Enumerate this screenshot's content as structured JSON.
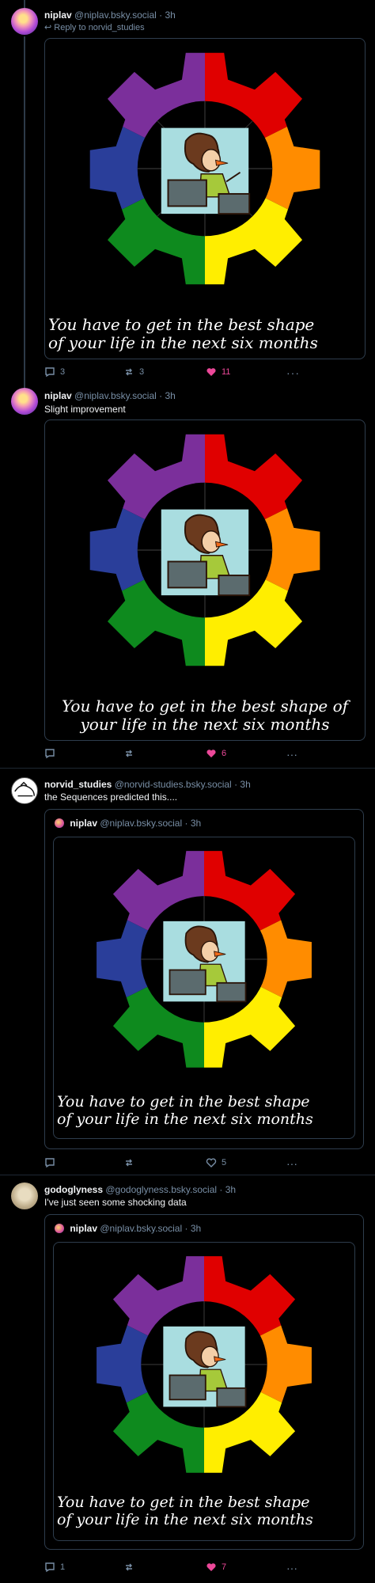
{
  "posts": [
    {
      "author": "niplav",
      "handle": "@niplav.bsky.social",
      "time": "3h",
      "reply_to": "Reply to norvid_studies",
      "caption": "You have to get in the best shape of your life in the next six months",
      "stats": {
        "replies": "3",
        "reposts": "3",
        "likes": "11",
        "liked": true
      }
    },
    {
      "author": "niplav",
      "handle": "@niplav.bsky.social",
      "time": "3h",
      "text": "Slight improvement",
      "caption": "You have to get in the best shape of your life in the next six months",
      "stats": {
        "replies": "",
        "reposts": "",
        "likes": "6",
        "liked": true
      }
    },
    {
      "author": "norvid_studies",
      "handle": "@norvid-studies.bsky.social",
      "time": "3h",
      "text": "the Sequences predicted this....",
      "quote": {
        "author": "niplav",
        "handle": "@niplav.bsky.social",
        "time": "3h"
      },
      "caption": "You have to get in the best shape of your life in the next six months",
      "stats": {
        "replies": "",
        "reposts": "",
        "likes": "5",
        "liked": false
      }
    },
    {
      "author": "godoglyness",
      "handle": "@godoglyness.bsky.social",
      "time": "3h",
      "text": "I've just seen some shocking data",
      "quote": {
        "author": "niplav",
        "handle": "@niplav.bsky.social",
        "time": "3h"
      },
      "caption": "You have to get in the best shape of your life in the next six months",
      "stats": {
        "replies": "1",
        "reposts": "",
        "likes": "7",
        "liked": true
      }
    }
  ],
  "colors": {
    "like": "#ec4899",
    "muted": "#788ea5",
    "border": "#2e3d4d"
  },
  "icons": [
    "reply-icon",
    "repost-icon",
    "like-icon",
    "more-icon"
  ]
}
